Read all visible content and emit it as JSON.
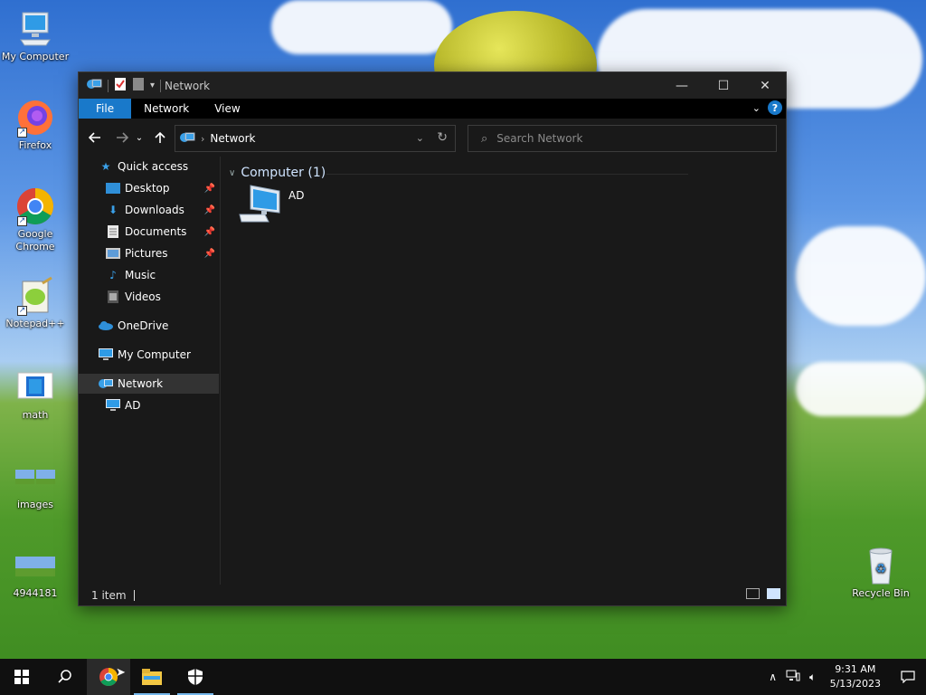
{
  "desktop": {
    "icons": [
      {
        "label": "My Computer"
      },
      {
        "label": "Firefox"
      },
      {
        "label": "Google Chrome"
      },
      {
        "label": "Notepad++"
      },
      {
        "label": "math"
      },
      {
        "label": "images"
      },
      {
        "label": "4944181"
      },
      {
        "label": "Recycle Bin"
      }
    ]
  },
  "window": {
    "title": "Network",
    "ribbon_tabs": [
      "File",
      "Network",
      "View"
    ],
    "address": {
      "breadcrumb": "Network"
    },
    "search": {
      "placeholder": "Search Network"
    },
    "nav_pane": {
      "quick_access": "Quick access",
      "quick_items": [
        {
          "label": "Desktop",
          "pinned": true
        },
        {
          "label": "Downloads",
          "pinned": true
        },
        {
          "label": "Documents",
          "pinned": true
        },
        {
          "label": "Pictures",
          "pinned": true
        },
        {
          "label": "Music",
          "pinned": false
        },
        {
          "label": "Videos",
          "pinned": false
        }
      ],
      "onedrive": "OneDrive",
      "my_computer": "My Computer",
      "network": "Network",
      "network_children": [
        "AD"
      ]
    },
    "content": {
      "group_header": "Computer (1)",
      "items": [
        {
          "label": "AD",
          "icon": "computer-icon"
        }
      ]
    },
    "status": {
      "item_count": "1 item"
    }
  },
  "taskbar": {
    "pinned": [
      "start-icon",
      "search-icon",
      "chrome-icon",
      "file-explorer-icon",
      "security-icon"
    ],
    "clock": {
      "time": "9:31 AM",
      "date": "5/13/2023"
    }
  },
  "colors": {
    "accent": "#1979ca",
    "window_bg": "#191919",
    "ribbon_bg": "#000000",
    "taskbar_bg": "#101010"
  }
}
